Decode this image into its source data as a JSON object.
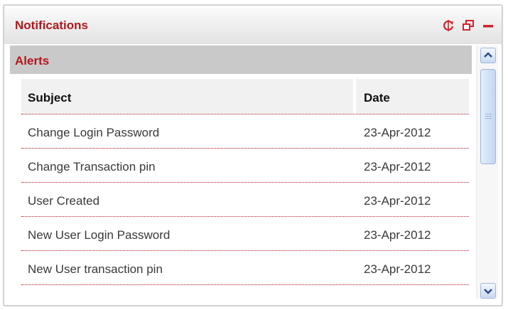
{
  "panel": {
    "title": "Notifications",
    "icons": [
      "refresh-icon",
      "restore-window-icon",
      "minimize-icon"
    ],
    "accent_color": "#b1171d"
  },
  "section": {
    "title": "Alerts"
  },
  "table": {
    "headers": {
      "subject": "Subject",
      "date": "Date"
    },
    "rows": [
      {
        "subject": "Change Login Password",
        "date": "23-Apr-2012"
      },
      {
        "subject": "Change Transaction pin",
        "date": "23-Apr-2012"
      },
      {
        "subject": "User Created",
        "date": "23-Apr-2012"
      },
      {
        "subject": "New User Login Password",
        "date": "23-Apr-2012"
      },
      {
        "subject": "New User transaction pin",
        "date": "23-Apr-2012"
      }
    ]
  }
}
